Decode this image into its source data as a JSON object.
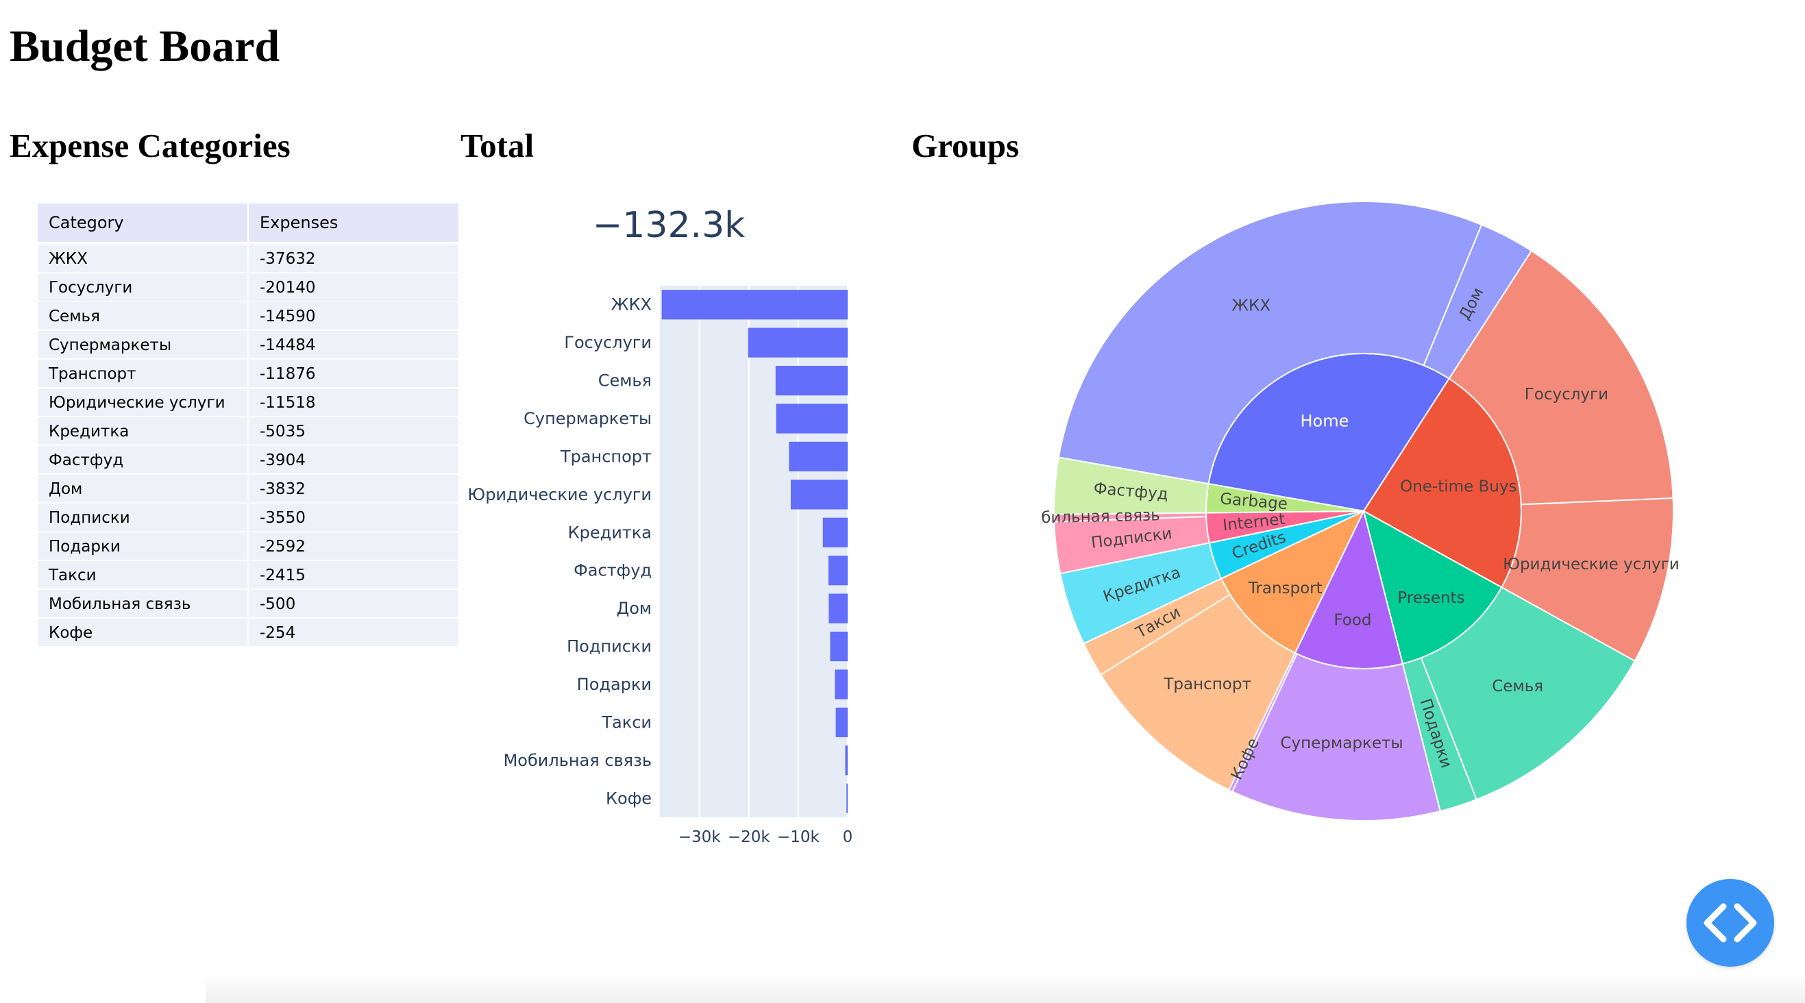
{
  "page": {
    "title": "Budget Board",
    "sections": {
      "categories": "Expense Categories",
      "total": "Total",
      "groups": "Groups"
    }
  },
  "table": {
    "headers": [
      "Category",
      "Expenses"
    ],
    "rows": [
      [
        "ЖКХ",
        "-37632"
      ],
      [
        "Госуслуги",
        "-20140"
      ],
      [
        "Семья",
        "-14590"
      ],
      [
        "Супермаркеты",
        "-14484"
      ],
      [
        "Транспорт",
        "-11876"
      ],
      [
        "Юридические услуги",
        "-11518"
      ],
      [
        "Кредитка",
        "-5035"
      ],
      [
        "Фастфуд",
        "-3904"
      ],
      [
        "Дом",
        "-3832"
      ],
      [
        "Подписки",
        "-3550"
      ],
      [
        "Подарки",
        "-2592"
      ],
      [
        "Такси",
        "-2415"
      ],
      [
        "Мобильная связь",
        "-500"
      ],
      [
        "Кофе",
        "-254"
      ]
    ]
  },
  "kpi": {
    "value": "−132.3k"
  },
  "chart_data": [
    {
      "type": "bar",
      "orientation": "horizontal",
      "categories": [
        "ЖКХ",
        "Госуслуги",
        "Семья",
        "Супермаркеты",
        "Транспорт",
        "Юридические услуги",
        "Кредитка",
        "Фастфуд",
        "Дом",
        "Подписки",
        "Подарки",
        "Такси",
        "Мобильная связь",
        "Кофе"
      ],
      "values": [
        -37632,
        -20140,
        -14590,
        -14484,
        -11876,
        -11518,
        -5035,
        -3904,
        -3832,
        -3550,
        -2592,
        -2415,
        -500,
        -254
      ],
      "xlim": [
        -38000,
        0
      ],
      "x_ticks": [
        -30000,
        -20000,
        -10000,
        0
      ],
      "x_tick_labels": [
        "−30k",
        "−20k",
        "−10k",
        "0"
      ],
      "grid": true,
      "color": "#636efa",
      "background": "#e5ecf6"
    },
    {
      "type": "sunburst",
      "groups": [
        {
          "name": "Home",
          "color": "#636efa",
          "children": [
            {
              "name": "ЖКХ",
              "value": 37632
            },
            {
              "name": "Дом",
              "value": 3832
            }
          ]
        },
        {
          "name": "One-time Buys",
          "color": "#ef553b",
          "children": [
            {
              "name": "Госуслуги",
              "value": 20140
            },
            {
              "name": "Юридические услуги",
              "value": 11518
            }
          ]
        },
        {
          "name": "Presents",
          "color": "#00cc96",
          "children": [
            {
              "name": "Семья",
              "value": 14590
            },
            {
              "name": "Подарки",
              "value": 2592
            }
          ]
        },
        {
          "name": "Food",
          "color": "#ab63fa",
          "children": [
            {
              "name": "Супермаркеты",
              "value": 14484
            },
            {
              "name": "Кофе",
              "value": 254
            }
          ]
        },
        {
          "name": "Transport",
          "color": "#ffa15a",
          "children": [
            {
              "name": "Транспорт",
              "value": 11876
            },
            {
              "name": "Такси",
              "value": 2415
            }
          ]
        },
        {
          "name": "Credits",
          "color": "#19d3f3",
          "children": [
            {
              "name": "Кредитка",
              "value": 5035
            }
          ]
        },
        {
          "name": "Internet",
          "color": "#ff6692",
          "children": [
            {
              "name": "Подписки",
              "value": 3550
            },
            {
              "name": "Мобильная связь",
              "value": 500
            }
          ]
        },
        {
          "name": "Garbage",
          "color": "#b6e880",
          "children": [
            {
              "name": "Фастфуд",
              "value": 3904
            }
          ]
        }
      ]
    }
  ],
  "colors": {
    "toggle_button": "#3c94f5",
    "table_header": "#e5e5fa",
    "table_cell": "#eef1f8"
  },
  "icons": {
    "toggle": "code-brackets-icon"
  }
}
